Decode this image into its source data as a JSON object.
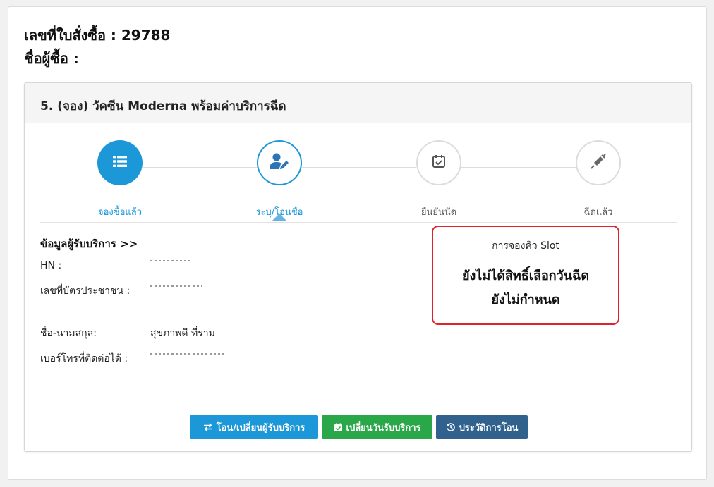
{
  "order": {
    "label": "เลขที่ใบสั่งซื้อ : 29788"
  },
  "buyer": {
    "label": "ชื่อผู้ซื้อ :"
  },
  "product": {
    "title": "5. (จอง) วัคซีน Moderna พร้อมค่าบริการฉีด"
  },
  "steps": [
    {
      "label": "จองซื้อแล้ว",
      "icon": "list-icon",
      "state": "done"
    },
    {
      "label": "ระบุ/โอนชื่อ",
      "icon": "user-edit-icon",
      "state": "current"
    },
    {
      "label": "ยืนยันนัด",
      "icon": "calendar-check-icon",
      "state": "todo"
    },
    {
      "label": "ฉีดแล้ว",
      "icon": "syringe-icon",
      "state": "todo"
    }
  ],
  "info": {
    "title": "ข้อมูลผู้รับบริการ >>",
    "hn_label": "HN :",
    "id_label": "เลขที่บัตรประชาชน :",
    "name_label": "ชื่อ-นามสกุล:",
    "name_value": "สุขภาพดี ที่ราม",
    "phone_label": "เบอร์โทรที่ติดต่อได้ :"
  },
  "slot": {
    "title": "การจองคิว Slot",
    "line1": "ยังไม่ได้สิทธิ์เลือกวันฉีด",
    "line2": "ยังไม่กำหนด"
  },
  "buttons": {
    "transfer": "โอน/เปลี่ยนผู้รับบริการ",
    "change_date": "เปลี่ยนวันรับบริการ",
    "history": "ประวัติการโอน"
  },
  "colors": {
    "primary": "#1c98d8",
    "success": "#2aa748",
    "navy": "#31628d",
    "alert_border": "#e0232b"
  }
}
